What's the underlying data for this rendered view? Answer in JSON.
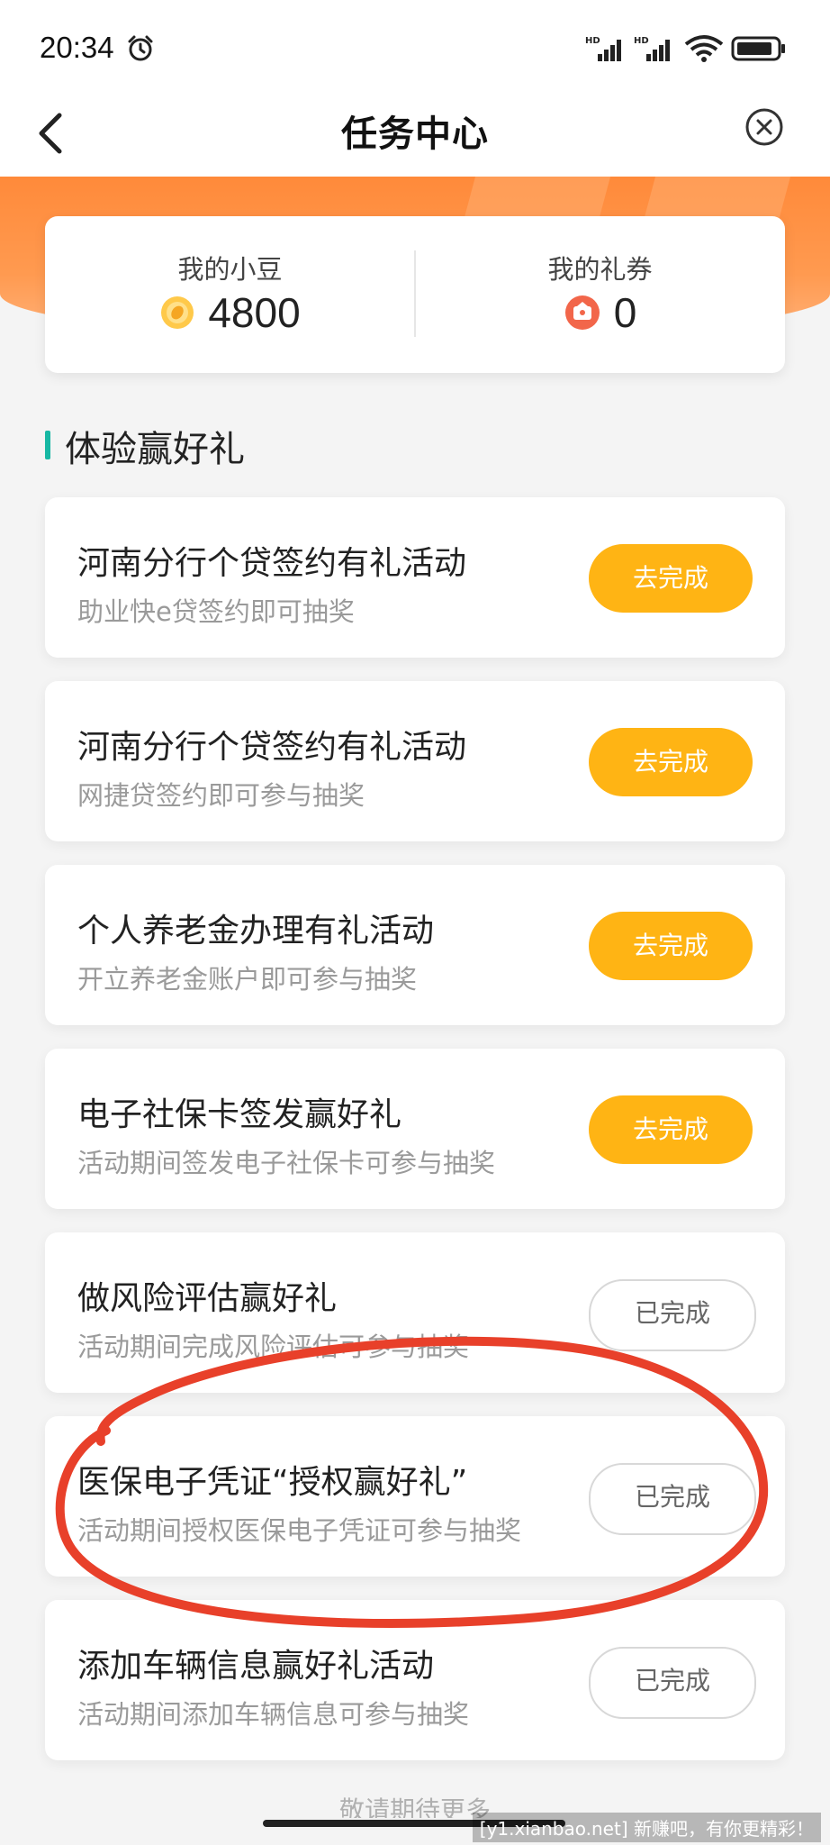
{
  "status_bar": {
    "time": "20:34"
  },
  "nav": {
    "title": "任务中心"
  },
  "summary": {
    "beans_label": "我的小豆",
    "beans_value": "4800",
    "coupons_label": "我的礼券",
    "coupons_value": "0"
  },
  "section": {
    "title": "体验赢好礼"
  },
  "tasks": [
    {
      "title": "河南分行个贷签约有礼活动",
      "subtitle": "助业快e贷签约即可抽奖",
      "button": "去完成"
    },
    {
      "title": "河南分行个贷签约有礼活动",
      "subtitle": "网捷贷签约即可参与抽奖",
      "button": "去完成"
    },
    {
      "title": "个人养老金办理有礼活动",
      "subtitle": "开立养老金账户即可参与抽奖",
      "button": "去完成"
    },
    {
      "title": "电子社保卡签发赢好礼",
      "subtitle": "活动期间签发电子社保卡可参与抽奖",
      "button": "去完成"
    },
    {
      "title": "做风险评估赢好礼",
      "subtitle": "活动期间完成风险评估可参与抽奖",
      "button": "已完成"
    },
    {
      "title": "医保电子凭证“授权赢好礼”",
      "subtitle": "活动期间授权医保电子凭证可参与抽奖",
      "button": "已完成"
    },
    {
      "title": "添加车辆信息赢好礼活动",
      "subtitle": "活动期间添加车辆信息可参与抽奖",
      "button": "已完成"
    }
  ],
  "footer": {
    "hint": "敬请期待更多"
  },
  "watermark": "[y1.xianbao.net] 新赚吧，有你更精彩！",
  "colors": {
    "accent_orange": "#ff8a3a",
    "button_yellow": "#ffb414",
    "section_bar": "#17b8a4",
    "annotation_red": "#e8402a"
  }
}
